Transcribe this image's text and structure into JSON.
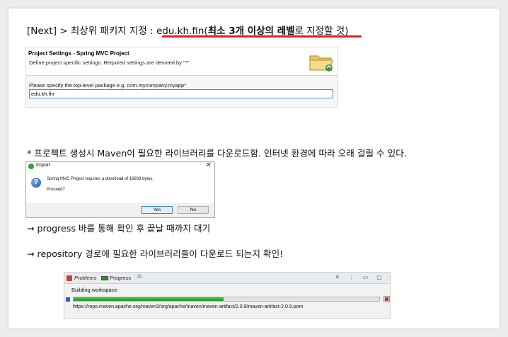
{
  "step1": {
    "prefix": "[Next] > 최상위 패키지 지정 : ",
    "package": "edu.kh.fin",
    "open_paren": "(",
    "bold": "최소 3개 이상의 레벨",
    "suffix": "로 지정할 것)",
    "underline_color": "#e0201e"
  },
  "project_settings": {
    "title": "Project Settings - Spring MVC Project",
    "description": "Define project specific settings. Required settings are denoted by \"*\".",
    "field_label": "Please specify the top-level package e.g. com.mycompany.myapp*",
    "field_value": "edu.kh.fin",
    "icon": "folder-wizard-icon"
  },
  "note": "* 프로젝트 생성시 Maven이 필요한 라이브러리를 다운로드함. 인터넷 환경에 따라 오래 걸릴 수 있다.",
  "import_dialog": {
    "title": "Import",
    "message": "Spring MVC Project requires a download of 16608 bytes.",
    "question": "Proceed?",
    "yes_label": "Yes",
    "no_label": "No",
    "close_glyph": "✕",
    "icon": "question-icon"
  },
  "arrow_notes": [
    "→ progress 바를 통해 확인 후 끝날 때까지 대기",
    "→ repository 경로에 필요한 라이브러리들이 다운로드 되는지 확인!"
  ],
  "progress_view": {
    "tabs": [
      "Problems",
      "Progress"
    ],
    "tab_close": "☒",
    "toolbar": "✕ ⋮ ▭ ▢",
    "job": "Building workspace",
    "progress": 0.49,
    "url": "https://repo.maven.apache.org/maven2/org/apache/maven/maven-artifact/2.0.9/maven-artifact-2.0.9.pom",
    "accent_color": "#1e9a1e"
  }
}
